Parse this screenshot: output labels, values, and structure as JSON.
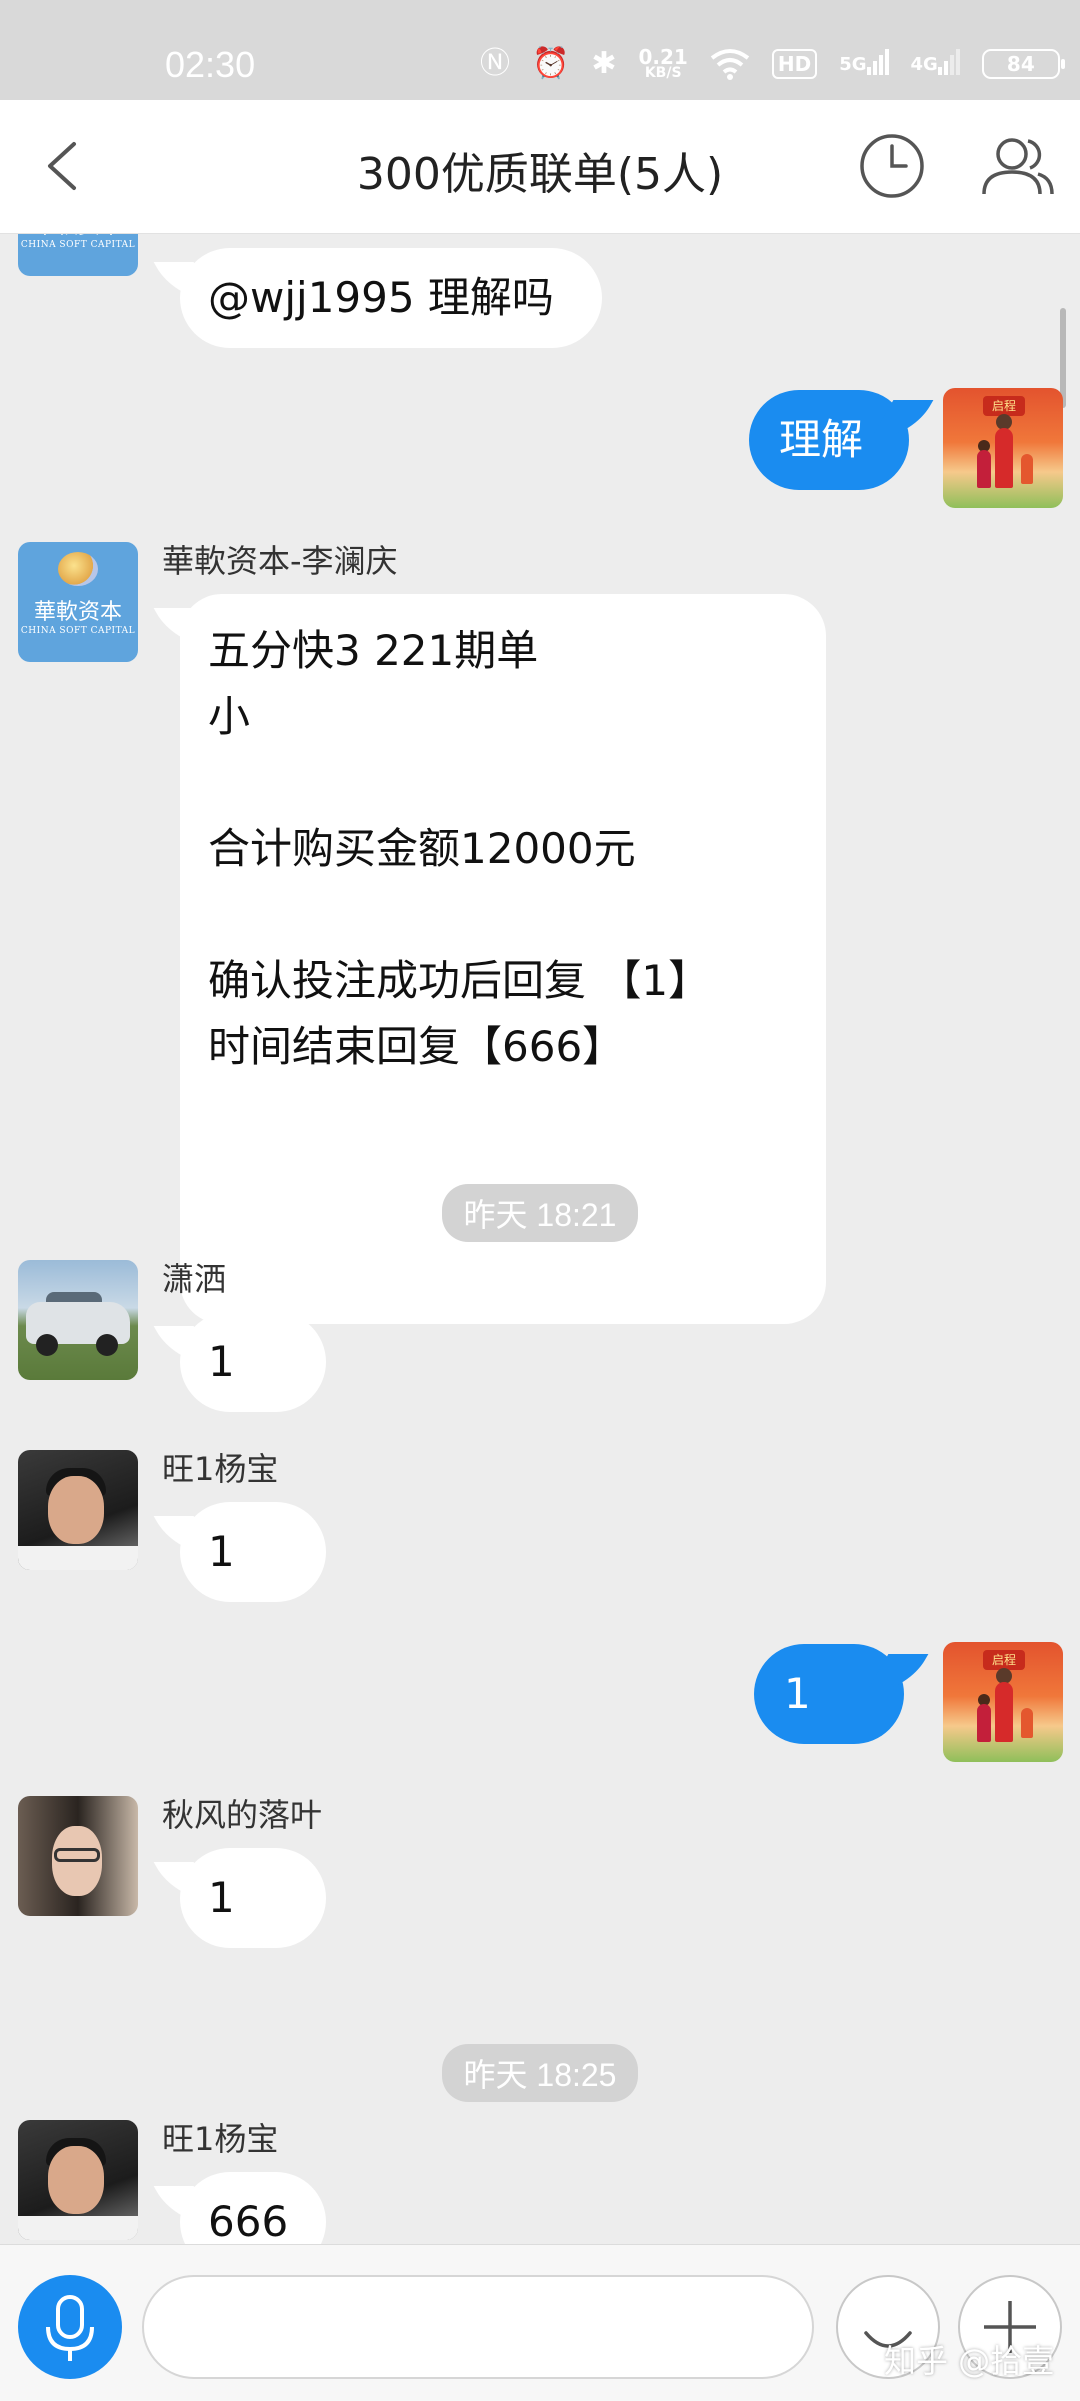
{
  "status_bar": {
    "time": "02:30",
    "speed_value": "0.21",
    "speed_unit": "KB/S",
    "hd_label": "HD",
    "net1": "5G",
    "net2": "4G",
    "battery": "84"
  },
  "header": {
    "title": "300优质联单(5人)"
  },
  "messages": [
    {
      "sender": "",
      "text": "@wjj1995 理解吗"
    },
    {
      "sender": "",
      "text": "理解"
    },
    {
      "sender": "華軟资本-李澜庆",
      "text": "五分快3 221期单\n小\n\n合计购买金额12000元\n\n确认投注成功后回复 【1】\n时间结束回复【666】"
    },
    {
      "sender": "潇洒",
      "text": "1"
    },
    {
      "sender": "旺1杨宝",
      "text": "1"
    },
    {
      "sender": "",
      "text": "1"
    },
    {
      "sender": "秋风的落叶",
      "text": "1"
    },
    {
      "sender": "旺1杨宝",
      "text": "666"
    }
  ],
  "timestamps": [
    "昨天 18:21",
    "昨天 18:25"
  ],
  "avatars": {
    "logo_cn": "華軟资本",
    "logo_en": "CHINA SOFT CAPITAL",
    "festive_badge": "启程"
  },
  "watermark": "知乎 @拾壹",
  "colors": {
    "outgoing_bubble": "#1a8cf0",
    "incoming_bubble": "#ffffff",
    "chat_background": "#ededed"
  },
  "icons": [
    "back-arrow-icon",
    "clock-icon",
    "members-icon",
    "microphone-icon",
    "emoji-icon",
    "plus-icon"
  ]
}
